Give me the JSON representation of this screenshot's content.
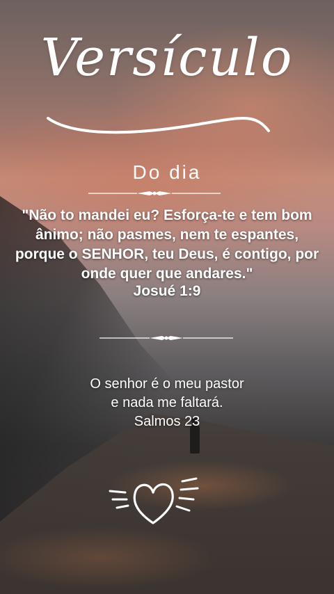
{
  "header": {
    "title": "Versículo",
    "subtitle": "Do dia"
  },
  "verse": {
    "text": "\"Não to mandei eu? Esforça-te e tem bom ânimo; não pasmes, nem te espantes, porque o SENHOR, teu Deus, é contigo, por onde quer que andares.\"",
    "reference": "Josué 1:9"
  },
  "secondary_verse": {
    "line1": "O senhor é o meu pastor",
    "line2": "e nada me faltará.",
    "reference": "Salmos 23"
  },
  "icons": {
    "divider": "ornamental-divider-icon",
    "heart": "heart-icon"
  },
  "colors": {
    "text": "#ffffff",
    "sky_accent": "#c58c78",
    "rock": "#3c3a3a"
  }
}
